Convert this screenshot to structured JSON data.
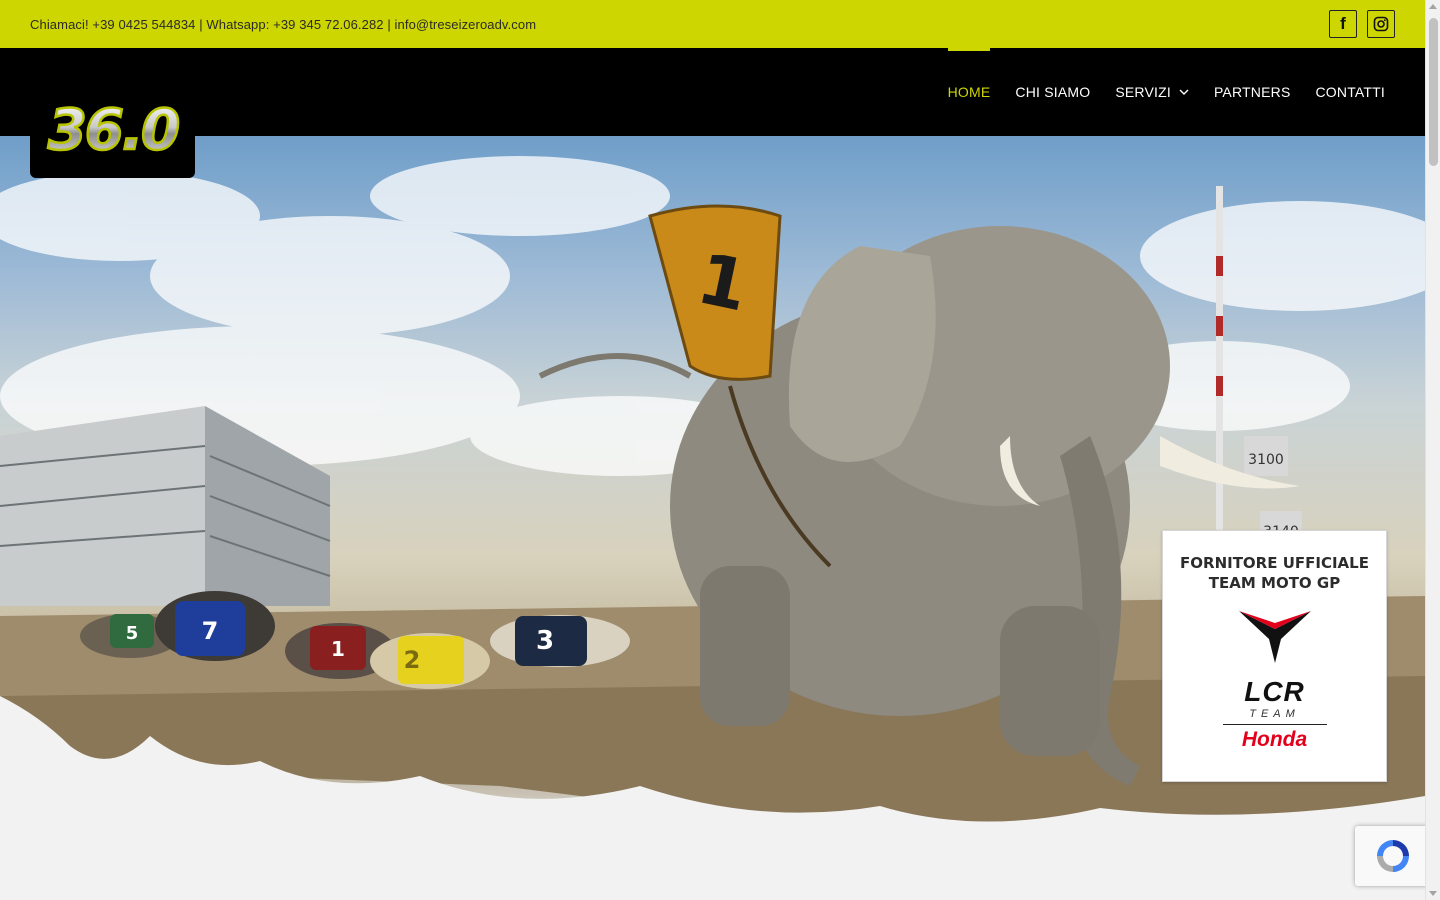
{
  "topbar": {
    "contact_text": "Chiamaci! +39 0425 544834 | Whatsapp: +39 345 72.06.282  |  info@treseizeroadv.com",
    "social": [
      {
        "icon": "facebook-icon",
        "label": "f"
      },
      {
        "icon": "instagram-icon"
      }
    ],
    "background": "#cdd600"
  },
  "logo": {
    "text": "36.0"
  },
  "nav": {
    "items": [
      {
        "label": "HOME",
        "active": true
      },
      {
        "label": "CHI SIAMO"
      },
      {
        "label": "SERVIZI",
        "has_dropdown": true
      },
      {
        "label": "PARTNERS"
      },
      {
        "label": "CONTATTI"
      }
    ],
    "accent": "#cdd600"
  },
  "hero": {
    "saddle_number": "1",
    "dog_numbers": [
      "5",
      "7",
      "1",
      "2",
      "3"
    ],
    "post_signs": [
      "3100",
      "3140"
    ]
  },
  "sponsor": {
    "title_line1": "FORNITORE UFFICIALE",
    "title_line2": "TEAM MOTO GP",
    "brand": "LCR",
    "brand_sub": "TEAM",
    "partner": "Honda",
    "partner_color": "#e3001b"
  }
}
